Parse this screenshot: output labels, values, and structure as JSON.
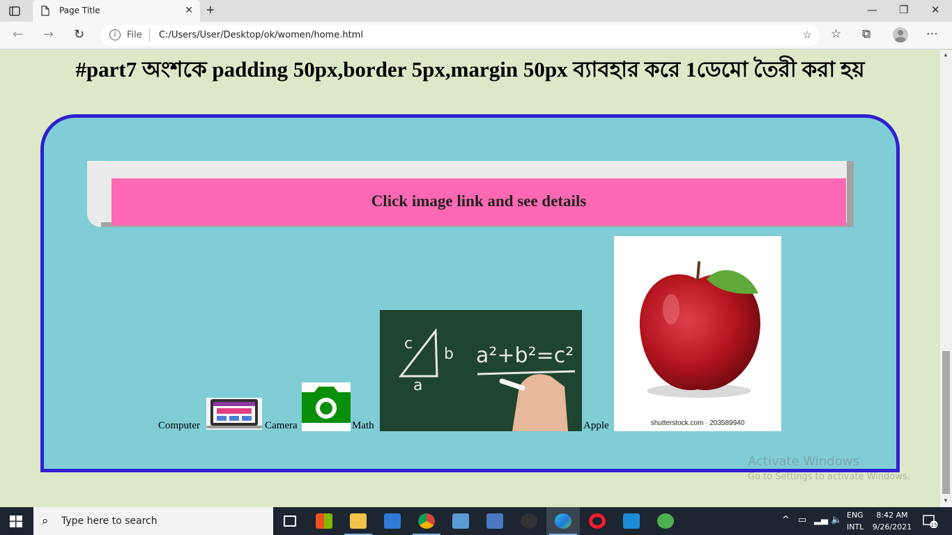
{
  "browser": {
    "tab_title": "Page Title",
    "address_scheme": "File",
    "address_url": "C:/Users/User/Desktop/ok/women/home.html"
  },
  "page": {
    "heading": "#part7 অংশকে padding 50px,border 5px,margin 50px ব্যাবহার করে 1ডেমো তৈরী করা হয়",
    "banner_text": "Click image link and see details",
    "links": [
      {
        "label": "Computer"
      },
      {
        "label": "Camera"
      },
      {
        "label": "Math"
      },
      {
        "label": "Apple"
      }
    ],
    "apple_watermark": "shutterstock.com · 203589940",
    "colors": {
      "page_bg": "#dde8c8",
      "box_bg": "#80cdd6",
      "box_border": "#2f1fd0",
      "banner": "#ff69b4"
    }
  },
  "os": {
    "activate_title": "Activate Windows",
    "activate_sub": "Go to Settings to activate Windows.",
    "search_placeholder": "Type here to search",
    "lang_top": "ENG",
    "lang_bottom": "INTL",
    "time": "8:42 AM",
    "date": "9/26/2021",
    "notification_count": "15"
  }
}
